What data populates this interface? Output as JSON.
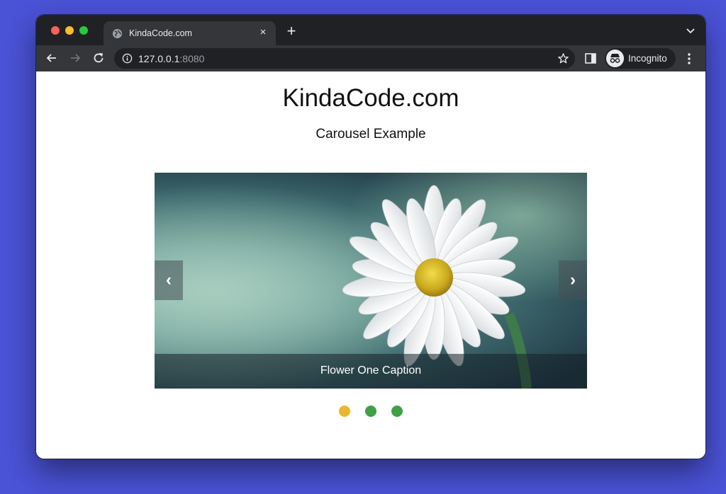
{
  "browser": {
    "tab_title": "KindaCode.com",
    "tab_close": "×",
    "new_tab": "+",
    "url_host": "127.0.0.1",
    "url_port": ":8080",
    "incognito_label": "Incognito",
    "icons": {
      "favicon": "globe-icon",
      "back": "arrow-left-icon",
      "forward": "arrow-right-icon",
      "reload": "reload-icon",
      "info": "info-icon",
      "bookmark": "star-icon",
      "side_panel": "side-panel-icon",
      "incognito": "incognito-icon",
      "menu": "more-vertical-icon",
      "tab_list": "chevron-down-icon"
    }
  },
  "page": {
    "title": "KindaCode.com",
    "subtitle": "Carousel Example"
  },
  "carousel": {
    "prev_label": "‹",
    "next_label": "›",
    "caption": "Flower One Caption",
    "dots": [
      {
        "active": true,
        "color": "#e8b830"
      },
      {
        "active": false,
        "color": "#3fa046"
      },
      {
        "active": false,
        "color": "#3fa046"
      }
    ]
  }
}
